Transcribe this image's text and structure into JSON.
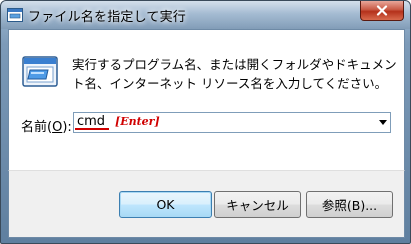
{
  "window": {
    "title": "ファイル名を指定して実行",
    "close_icon": "close-icon"
  },
  "dialog": {
    "icon": "run-dialog-icon",
    "description": "実行するプログラム名、または開くフォルダやドキュメント名、インターネット リソース名を入力してください。",
    "field_label_prefix": "名前(",
    "field_label_accel": "O",
    "field_label_suffix": "):",
    "input_value": "cmd",
    "annotation": "[Enter]"
  },
  "buttons": {
    "ok": "OK",
    "cancel": "キャンセル",
    "browse": "参照(B)..."
  },
  "colors": {
    "annotation": "#d00000",
    "default_button_border": "#3c7fb1"
  }
}
